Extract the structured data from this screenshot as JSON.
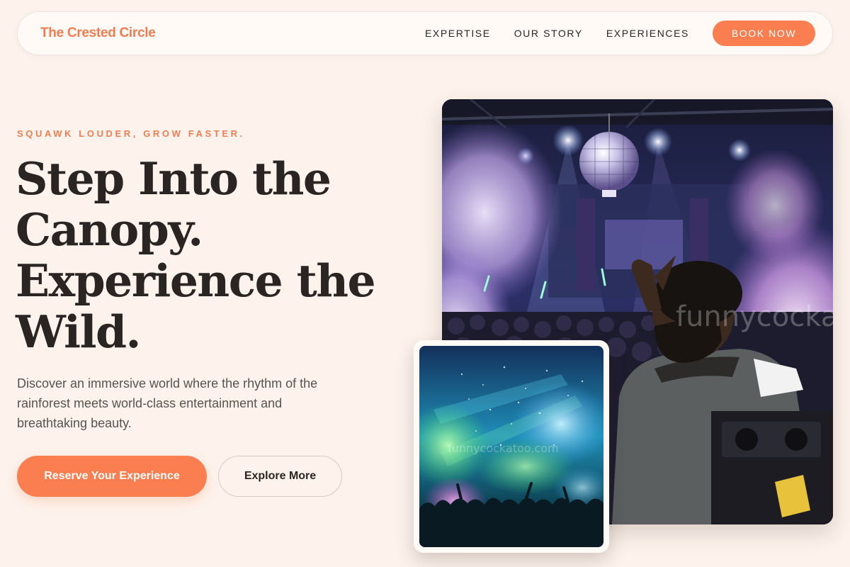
{
  "nav": {
    "brand": "The Crested Circle",
    "links": [
      "EXPERTISE",
      "OUR STORY",
      "EXPERIENCES"
    ],
    "cta": "BOOK NOW"
  },
  "hero": {
    "eyebrow": "SQUAWK LOUDER, GROW FASTER.",
    "headline_lines": [
      "Step Into the",
      "Canopy.",
      "Experience the",
      "Wild."
    ],
    "description": "Discover an immersive world where the rhythm of the rainforest meets world-class entertainment and breathtaking beauty.",
    "primary_button": "Reserve Your Experience",
    "secondary_button": "Explore More"
  },
  "images": {
    "main_watermark": "funnycockatoo.com",
    "secondary_watermark": "funnycockatoo.com"
  },
  "colors": {
    "accent": "#fb7e50",
    "brand": "#ef7d52",
    "background": "#fdf3ec",
    "text": "#2a2522"
  }
}
